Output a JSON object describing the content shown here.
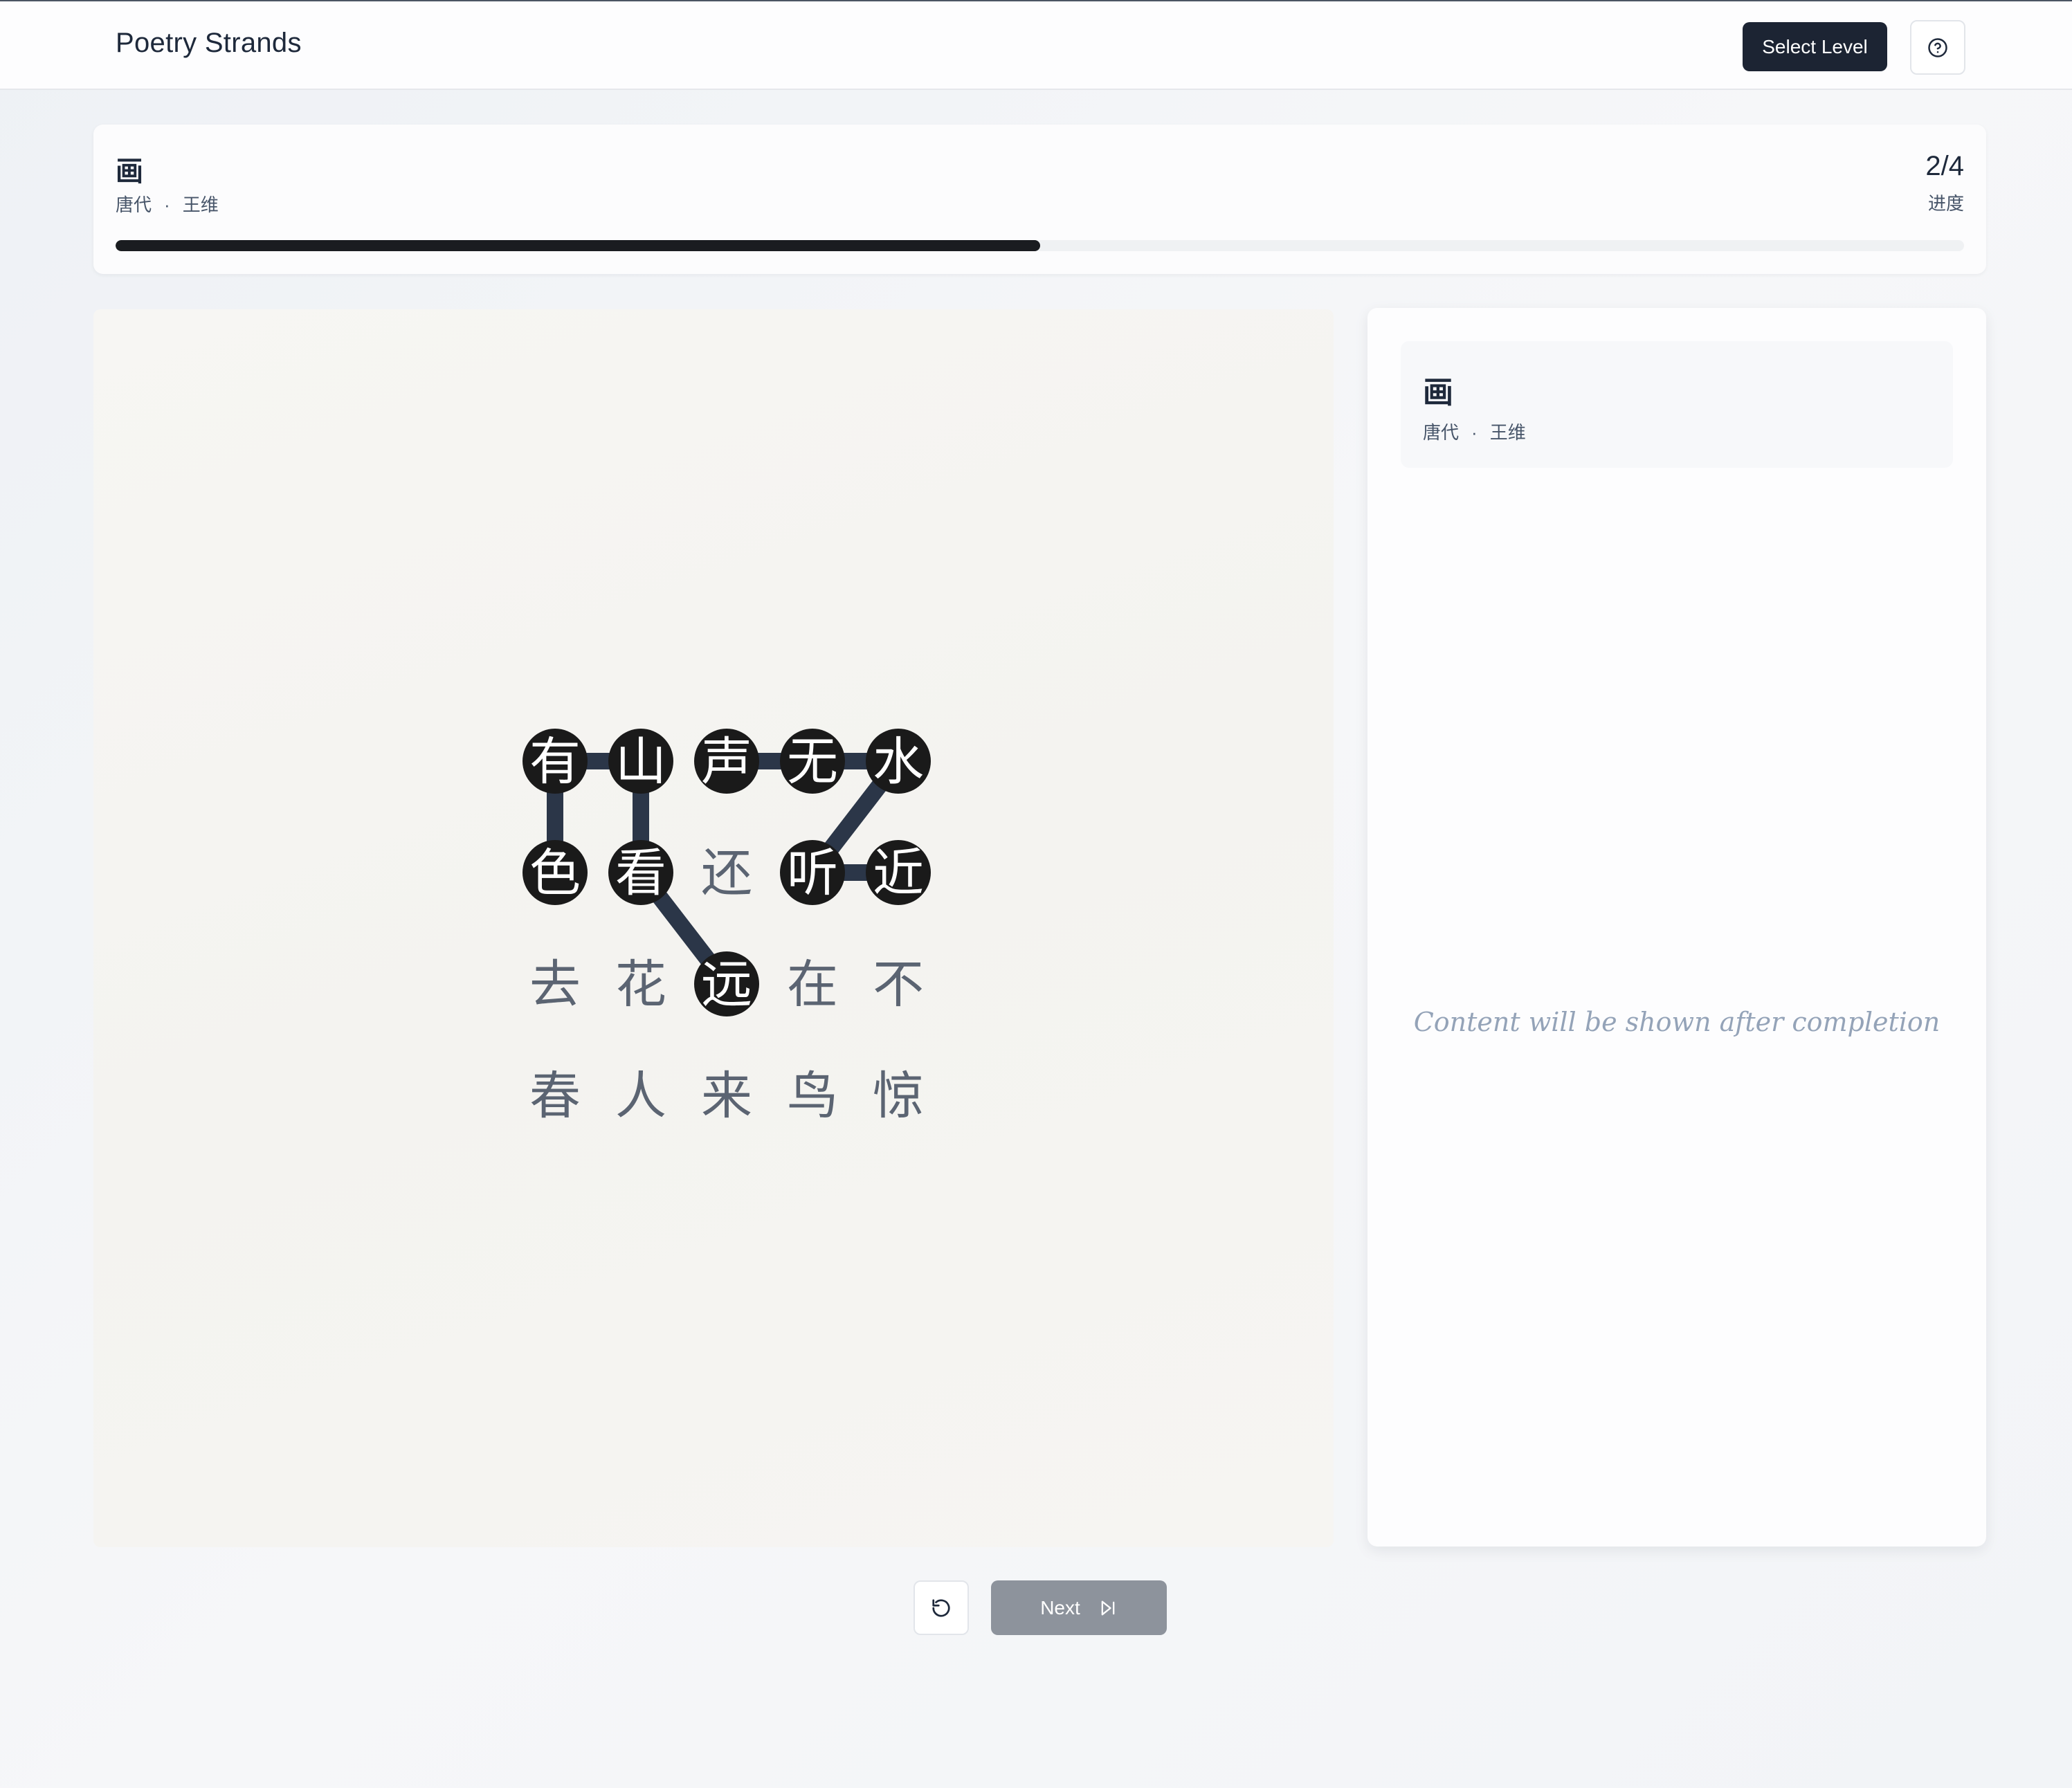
{
  "header": {
    "app_title": "Poetry Strands",
    "select_level_label": "Select Level",
    "help_icon": "help-circle-icon"
  },
  "poem": {
    "title": "画",
    "dynasty": "唐代",
    "separator": "·",
    "author": "王维"
  },
  "progress": {
    "count": "2/4",
    "label": "进度",
    "completed": 2,
    "total": 4
  },
  "board": {
    "rows": [
      [
        "有",
        "山",
        "声",
        "无",
        "水"
      ],
      [
        "色",
        "看",
        "还",
        "听",
        "近"
      ],
      [
        "去",
        "花",
        "远",
        "在",
        "不"
      ],
      [
        "春",
        "人",
        "来",
        "鸟",
        "惊"
      ]
    ],
    "selected": [
      [
        0,
        0
      ],
      [
        0,
        1
      ],
      [
        0,
        2
      ],
      [
        0,
        3
      ],
      [
        0,
        4
      ],
      [
        1,
        0
      ],
      [
        1,
        1
      ],
      [
        1,
        3
      ],
      [
        1,
        4
      ],
      [
        2,
        2
      ]
    ],
    "paths": [
      [
        [
          1,
          0
        ],
        [
          0,
          0
        ],
        [
          0,
          1
        ],
        [
          1,
          1
        ],
        [
          2,
          2
        ]
      ],
      [
        [
          0,
          2
        ],
        [
          0,
          3
        ],
        [
          0,
          4
        ],
        [
          1,
          3
        ],
        [
          1,
          4
        ]
      ]
    ],
    "colors": {
      "selected_fill": "#1a1a1a",
      "selected_text": "#ffffff",
      "idle_text": "#5b6472",
      "path": "#2b3648"
    }
  },
  "info_panel": {
    "title": "画",
    "dynasty": "唐代",
    "separator": "·",
    "author": "王维",
    "placeholder": "Content will be shown after completion"
  },
  "controls": {
    "reset_icon": "rotate-ccw-icon",
    "next_label": "Next",
    "next_icon": "skip-forward-icon"
  }
}
